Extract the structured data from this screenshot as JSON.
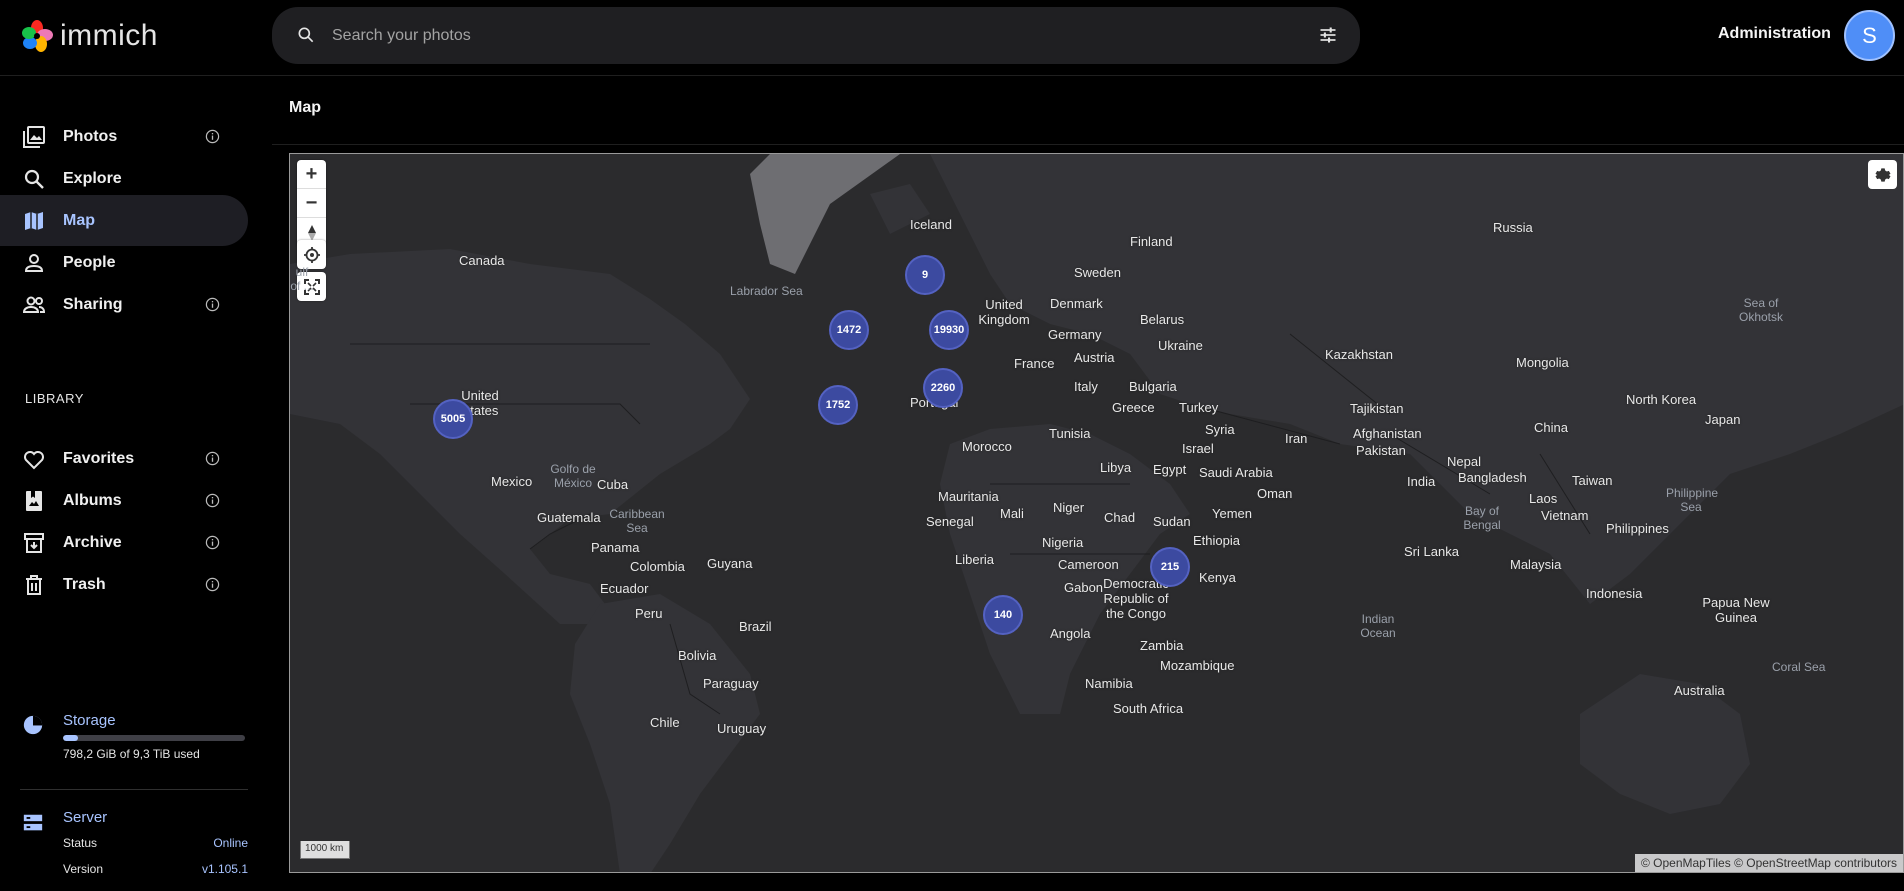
{
  "app": {
    "name": "immich"
  },
  "search": {
    "placeholder": "Search your photos"
  },
  "header": {
    "admin_label": "Administration",
    "avatar_initial": "S"
  },
  "sidebar": {
    "items": [
      {
        "label": "Photos",
        "icon": "photos-icon",
        "info": true
      },
      {
        "label": "Explore",
        "icon": "magnify-icon",
        "info": false
      },
      {
        "label": "Map",
        "icon": "map-icon",
        "info": false,
        "active": true
      },
      {
        "label": "People",
        "icon": "account-icon",
        "info": false
      },
      {
        "label": "Sharing",
        "icon": "account-multiple-icon",
        "info": true
      }
    ],
    "library_title": "LIBRARY",
    "library_items": [
      {
        "label": "Favorites",
        "icon": "heart-icon",
        "info": true
      },
      {
        "label": "Albums",
        "icon": "album-icon",
        "info": true
      },
      {
        "label": "Archive",
        "icon": "archive-icon",
        "info": true
      },
      {
        "label": "Trash",
        "icon": "trash-icon",
        "info": true
      }
    ],
    "storage": {
      "label": "Storage",
      "used_text": "798,2 GiB of 9,3 TiB used",
      "used_fraction": 0.085
    },
    "server": {
      "label": "Server",
      "status_label": "Status",
      "status_value": "Online",
      "version_label": "Version",
      "version_value": "v1.105.1"
    }
  },
  "page": {
    "title": "Map"
  },
  "map": {
    "clusters": [
      "9",
      "1472",
      "19930",
      "2260",
      "1752",
      "5005",
      "215",
      "140"
    ],
    "countries": [
      "Canada",
      "Iceland",
      "Finland",
      "Sweden",
      "Russia",
      "United Kingdom",
      "Denmark",
      "Belarus",
      "Germany",
      "Ukraine",
      "Kazakhstan",
      "Mongolia",
      "Austria",
      "France",
      "Italy",
      "Bulgaria",
      "United States",
      "Portugal",
      "Greece",
      "Turkey",
      "Tajikistan",
      "North Korea",
      "Japan",
      "Tunisia",
      "Syria",
      "Iran",
      "Afghanistan",
      "China",
      "Morocco",
      "Israel",
      "Pakistan",
      "Libya",
      "Egypt",
      "Saudi Arabia",
      "Nepal",
      "Mexico",
      "Cuba",
      "India",
      "Bangladesh",
      "Taiwan",
      "Oman",
      "Mauritania",
      "Laos",
      "Niger",
      "Mali",
      "Guatemala",
      "Chad",
      "Yemen",
      "Vietnam",
      "Senegal",
      "Sudan",
      "Philippines",
      "Ethiopia",
      "Panama",
      "Nigeria",
      "Sri Lanka",
      "Liberia",
      "Guyana",
      "Colombia",
      "Cameroon",
      "Malaysia",
      "Gabon",
      "Democratic Republic of the Congo",
      "Kenya",
      "Ecuador",
      "Indonesia",
      "Papua New Guinea",
      "Peru",
      "Brazil",
      "Angola",
      "Zambia",
      "Bolivia",
      "Mozambique",
      "Paraguay",
      "Namibia",
      "Australia",
      "South Africa",
      "Chile",
      "Uruguay"
    ],
    "seas": [
      "Labrador Sea",
      "Sea of Okhotsk",
      "Golfo de México",
      "Caribbean Sea",
      "Bay of Bengal",
      "Philippine Sea",
      "Indian Ocean",
      "Coral Sea",
      "ulf of ... as"
    ],
    "scale": "1000 km",
    "attribution": "© OpenMapTiles © OpenStreetMap contributors"
  },
  "colors": {
    "accent": "#a8c4ff",
    "cluster": "#3c4aa0",
    "avatar": "#4f8ef7"
  }
}
